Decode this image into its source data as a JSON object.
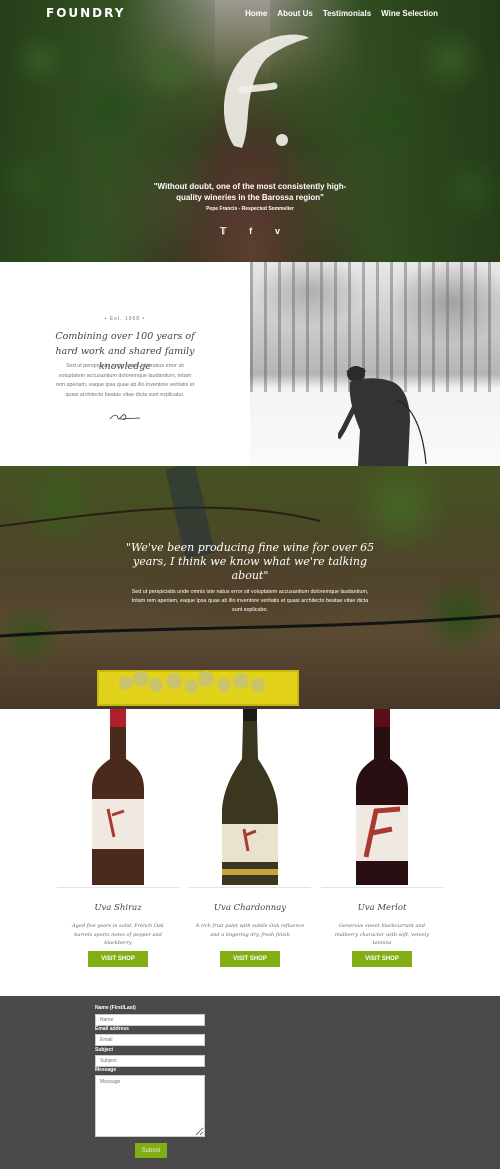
{
  "brand": {
    "logo": "FOUNDRY",
    "accent": "#82ae14"
  },
  "nav": {
    "items": [
      "Home",
      "About Us",
      "Testimonials",
      "Wine Selection"
    ]
  },
  "hero": {
    "quote": "\"Without doubt, one of the most consistently high-quality wineries in the Barossa region\"",
    "author": "Pepe Francis - Respected Sommelier",
    "social": [
      "twitter-icon",
      "facebook-icon",
      "vimeo-icon"
    ]
  },
  "about": {
    "est": "• Est. 1968 •",
    "heading": "Combining over 100 years of hard work and shared family knowledge",
    "body": "Sed ut perspiciatis unde omnis iste natus error sit voluptatem accusantium doloremque laudantium, totam rem aperiam, eaque ipsa quae ab illo inventore veritatis et quasi architecto beatae vitae dicta sunt explicabo."
  },
  "mid": {
    "quote": "\"We've been producing fine wine for over 65 years, I think we know what we're talking about\"",
    "body": "Sed ut perspiciatis unde omnis iste natus error sit voluptatem accusantium doloremque laudantium, totam rem aperiam, eaque ipsa quae ab illo inventore veritatis et quasi architecto beatae vitae dicta sunt explicabo."
  },
  "wines": [
    {
      "name": "Uva Shiraz",
      "desc": "Aged five years in solid, French Oak barrels sports notes of pepper and blackberry",
      "button": "VISIT SHOP"
    },
    {
      "name": "Uva Chardonnay",
      "desc": "A rich fruit palet with subtle Oak influence and a lingering dry, fresh finish",
      "button": "VISIT SHOP"
    },
    {
      "name": "Uva Merlot",
      "desc": "Generous sweet blackcurrant and mulberry character with soft, velvety tannins",
      "button": "VISIT SHOP"
    }
  ],
  "form": {
    "name_label": "Name (First/Last)",
    "name_placeholder": "Name",
    "email_label": "Email address",
    "email_placeholder": "Email",
    "subject_label": "Subject",
    "subject_placeholder": "Subject",
    "message_label": "Message",
    "message_placeholder": "Message",
    "submit": "Submit"
  }
}
